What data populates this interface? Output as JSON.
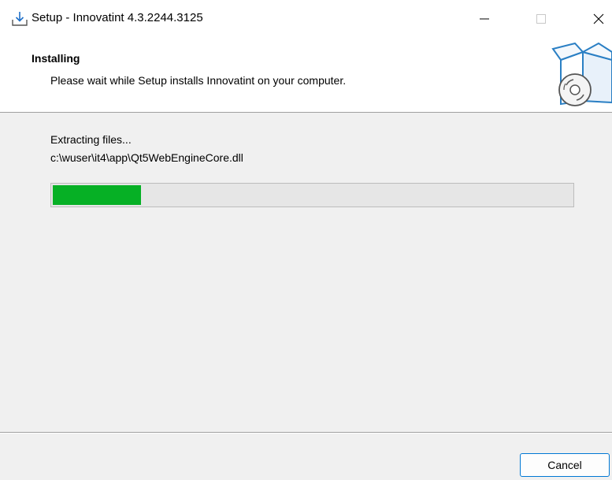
{
  "window": {
    "title": "Setup - Innovatint 4.3.2244.3125",
    "title_icon": "download-icon",
    "controls": [
      "minimize-icon",
      "maximize-icon",
      "close-icon"
    ]
  },
  "header": {
    "title": "Installing",
    "subtitle": "Please wait while Setup installs Innovatint on your computer.",
    "image": "setup-box-disc-icon"
  },
  "content": {
    "status": "Extracting files...",
    "current_file": "c:\\wuser\\it4\\app\\Qt5WebEngineCore.dll",
    "progress_fraction": 0.17
  },
  "footer": {
    "cancel_label": "Cancel"
  },
  "colors": {
    "progress": "#06b025",
    "accent": "#0078d4"
  }
}
